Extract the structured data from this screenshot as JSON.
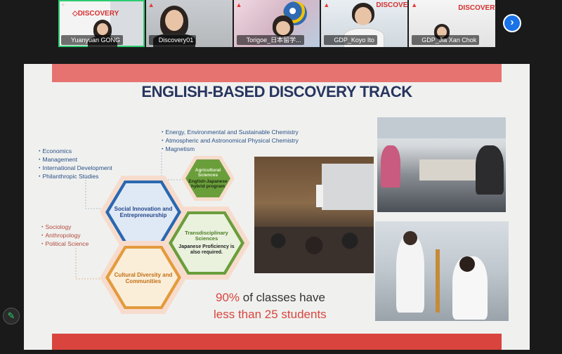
{
  "participants": [
    {
      "name": "Yuanyuan GONG",
      "pinned": true,
      "logo": "DISCOVERY"
    },
    {
      "name": "Discovery01",
      "pinned": false
    },
    {
      "name": "Torigoe_日本留学...",
      "pinned": false
    },
    {
      "name": "GDP_Koyo Ito",
      "pinned": false,
      "logo": "DISCOVERY"
    },
    {
      "name": "GDP_Jia Xan Chok",
      "pinned": false,
      "logo": "DISCOVERY"
    }
  ],
  "controls": {
    "next_icon": "chevron-right-icon",
    "next_glyph": "›",
    "edit_icon": "pencil-icon",
    "edit_glyph": "✎"
  },
  "slide": {
    "title": "ENGLISH-BASED DISCOVERY TRACK",
    "science_list": [
      "・Energy, Environmental and Sustainable Chemistry",
      "・Atmospheric and Astronomical Physical Chemistry",
      "・Magnetism"
    ],
    "economics_list": [
      "・Economics",
      "・Management",
      "・International Development",
      "・Philanthropic Studies"
    ],
    "sociology_list": [
      "・Sociology",
      "・Anthropology",
      "・Political Science"
    ],
    "hex_agri": {
      "title": "Agricultural Sciences",
      "note": "English-Japanese hybrid program"
    },
    "hex_social": {
      "title": "Social Innovation and Entrepreneurship"
    },
    "hex_trans": {
      "title": "Transdisciplinary Sciences",
      "note": "Japanese Proficiency is also required."
    },
    "hex_culture": {
      "title": "Cultural Diversity and Communities"
    },
    "stat_pct": "90%",
    "stat_line1": " of classes have",
    "stat_line2": "less than 25 students"
  },
  "colors": {
    "accent_red": "#d9453e",
    "navy": "#27355f",
    "blue_hex": "#2a68b0",
    "green_hex": "#6a9e3b",
    "orange_hex": "#e39b3d"
  }
}
